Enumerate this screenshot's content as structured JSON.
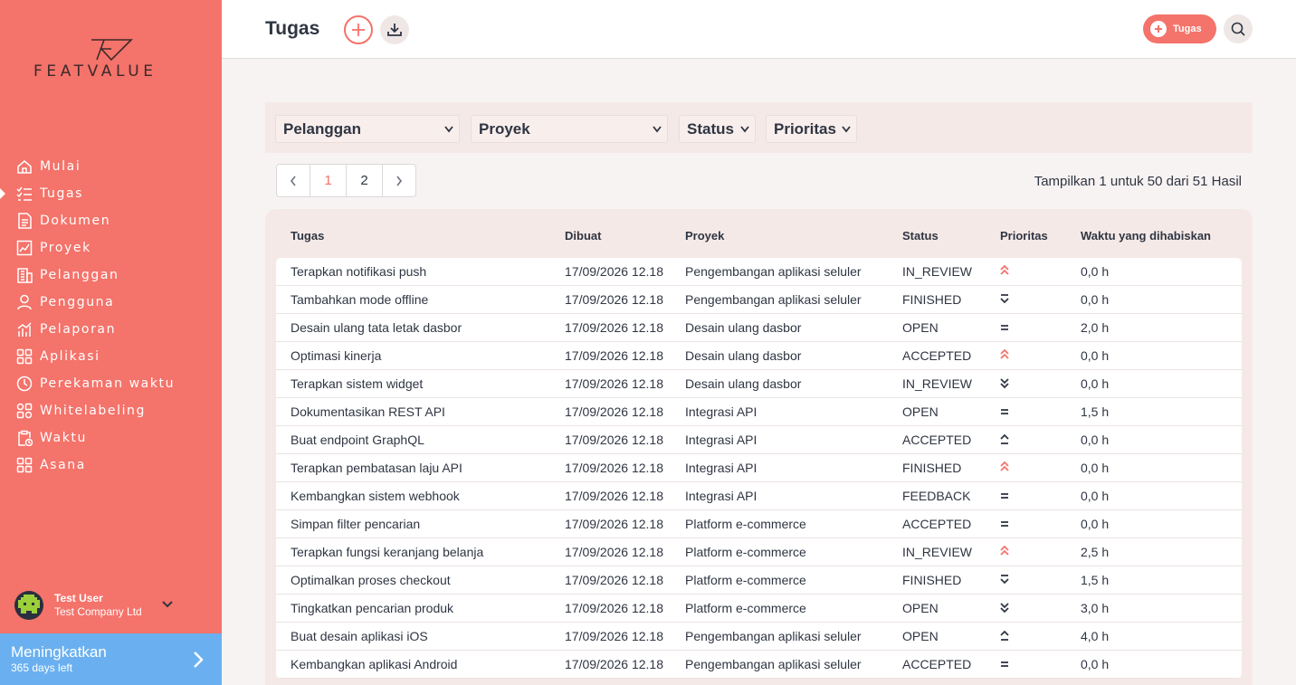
{
  "app": {
    "logo_text": "FEATVALUE",
    "accent_color": "#f4736a",
    "upgrade_color": "#6ab0f0"
  },
  "sidebar": {
    "items": [
      {
        "label": "Mulai",
        "icon": "home-icon",
        "active": false
      },
      {
        "label": "Tugas",
        "icon": "checklist-icon",
        "active": true
      },
      {
        "label": "Dokumen",
        "icon": "document-icon",
        "active": false
      },
      {
        "label": "Proyek",
        "icon": "project-icon",
        "active": false
      },
      {
        "label": "Pelanggan",
        "icon": "building-icon",
        "active": false
      },
      {
        "label": "Pengguna",
        "icon": "user-icon",
        "active": false
      },
      {
        "label": "Pelaporan",
        "icon": "report-icon",
        "active": false
      },
      {
        "label": "Aplikasi",
        "icon": "apps-icon",
        "active": false
      },
      {
        "label": "Perekaman waktu",
        "icon": "timer-icon",
        "active": false
      },
      {
        "label": "Whitelabeling",
        "icon": "whitelabel-icon",
        "active": false
      },
      {
        "label": "Waktu",
        "icon": "clipboard-clock-icon",
        "active": false
      },
      {
        "label": "Asana",
        "icon": "apps-icon",
        "active": false
      }
    ],
    "user": {
      "name": "Test User",
      "company": "Test Company Ltd"
    },
    "upgrade": {
      "title": "Meningkatkan",
      "subtitle": "365 days left"
    }
  },
  "header": {
    "title": "Tugas",
    "new_task_label": "Tugas"
  },
  "filters": {
    "customer": "Pelanggan",
    "project": "Proyek",
    "status": "Status",
    "priority": "Prioritas"
  },
  "pagination": {
    "pages": [
      "1",
      "2"
    ],
    "current": "1",
    "results_text": "Tampilkan 1 untuk 50 dari 51 Hasil"
  },
  "table": {
    "columns": {
      "task": "Tugas",
      "created": "Dibuat",
      "project": "Proyek",
      "status": "Status",
      "priority": "Prioritas",
      "time": "Waktu yang dihabiskan"
    },
    "rows": [
      {
        "task": "Terapkan notifikasi push",
        "created": "17/09/2026 12.18",
        "project": "Pengembangan aplikasi seluler",
        "status": "IN_REVIEW",
        "priority": "highest",
        "time": "0,0 h"
      },
      {
        "task": "Tambahkan mode offline",
        "created": "17/09/2026 12.18",
        "project": "Pengembangan aplikasi seluler",
        "status": "FINISHED",
        "priority": "lowest",
        "time": "0,0 h"
      },
      {
        "task": "Desain ulang tata letak dasbor",
        "created": "17/09/2026 12.18",
        "project": "Desain ulang dasbor",
        "status": "OPEN",
        "priority": "medium",
        "time": "2,0 h"
      },
      {
        "task": "Optimasi kinerja",
        "created": "17/09/2026 12.18",
        "project": "Desain ulang dasbor",
        "status": "ACCEPTED",
        "priority": "highest",
        "time": "0,0 h"
      },
      {
        "task": "Terapkan sistem widget",
        "created": "17/09/2026 12.18",
        "project": "Desain ulang dasbor",
        "status": "IN_REVIEW",
        "priority": "low",
        "time": "0,0 h"
      },
      {
        "task": "Dokumentasikan REST API",
        "created": "17/09/2026 12.18",
        "project": "Integrasi API",
        "status": "OPEN",
        "priority": "medium",
        "time": "1,5 h"
      },
      {
        "task": "Buat endpoint GraphQL",
        "created": "17/09/2026 12.18",
        "project": "Integrasi API",
        "status": "ACCEPTED",
        "priority": "high",
        "time": "0,0 h"
      },
      {
        "task": "Terapkan pembatasan laju API",
        "created": "17/09/2026 12.18",
        "project": "Integrasi API",
        "status": "FINISHED",
        "priority": "highest",
        "time": "0,0 h"
      },
      {
        "task": "Kembangkan sistem webhook",
        "created": "17/09/2026 12.18",
        "project": "Integrasi API",
        "status": "FEEDBACK",
        "priority": "medium",
        "time": "0,0 h"
      },
      {
        "task": "Simpan filter pencarian",
        "created": "17/09/2026 12.18",
        "project": "Platform e-commerce",
        "status": "ACCEPTED",
        "priority": "medium",
        "time": "0,0 h"
      },
      {
        "task": "Terapkan fungsi keranjang belanja",
        "created": "17/09/2026 12.18",
        "project": "Platform e-commerce",
        "status": "IN_REVIEW",
        "priority": "highest",
        "time": "2,5 h"
      },
      {
        "task": "Optimalkan proses checkout",
        "created": "17/09/2026 12.18",
        "project": "Platform e-commerce",
        "status": "FINISHED",
        "priority": "lowest",
        "time": "1,5 h"
      },
      {
        "task": "Tingkatkan pencarian produk",
        "created": "17/09/2026 12.18",
        "project": "Platform e-commerce",
        "status": "OPEN",
        "priority": "low",
        "time": "3,0 h"
      },
      {
        "task": "Buat desain aplikasi iOS",
        "created": "17/09/2026 12.18",
        "project": "Pengembangan aplikasi seluler",
        "status": "OPEN",
        "priority": "high",
        "time": "4,0 h"
      },
      {
        "task": "Kembangkan aplikasi Android",
        "created": "17/09/2026 12.18",
        "project": "Pengembangan aplikasi seluler",
        "status": "ACCEPTED",
        "priority": "medium",
        "time": "0,0 h"
      }
    ]
  }
}
